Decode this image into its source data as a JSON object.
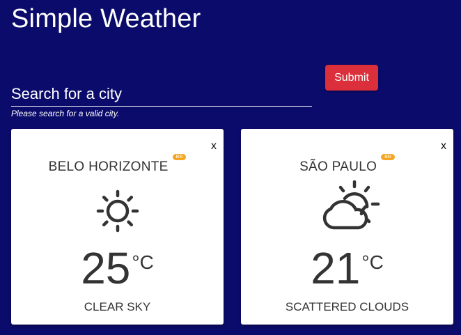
{
  "header": {
    "title": "Simple Weather"
  },
  "search": {
    "placeholder": "Search for a city",
    "value": "",
    "helper_text": "Please search for a valid city.",
    "submit_label": "Submit"
  },
  "cards": [
    {
      "city": "BELO HORIZONTE",
      "country": "BR",
      "temperature": "25",
      "unit": "°C",
      "description": "CLEAR SKY",
      "icon": "sun-icon",
      "close_label": "x"
    },
    {
      "city": "SÃO PAULO",
      "country": "BR",
      "temperature": "21",
      "unit": "°C",
      "description": "SCATTERED CLOUDS",
      "icon": "partly-cloudy-icon",
      "close_label": "x"
    }
  ],
  "colors": {
    "background": "#0b0b6b",
    "submit": "#dc2f3c",
    "badge": "#f5a623",
    "card": "#ffffff",
    "icon": "#333333"
  }
}
